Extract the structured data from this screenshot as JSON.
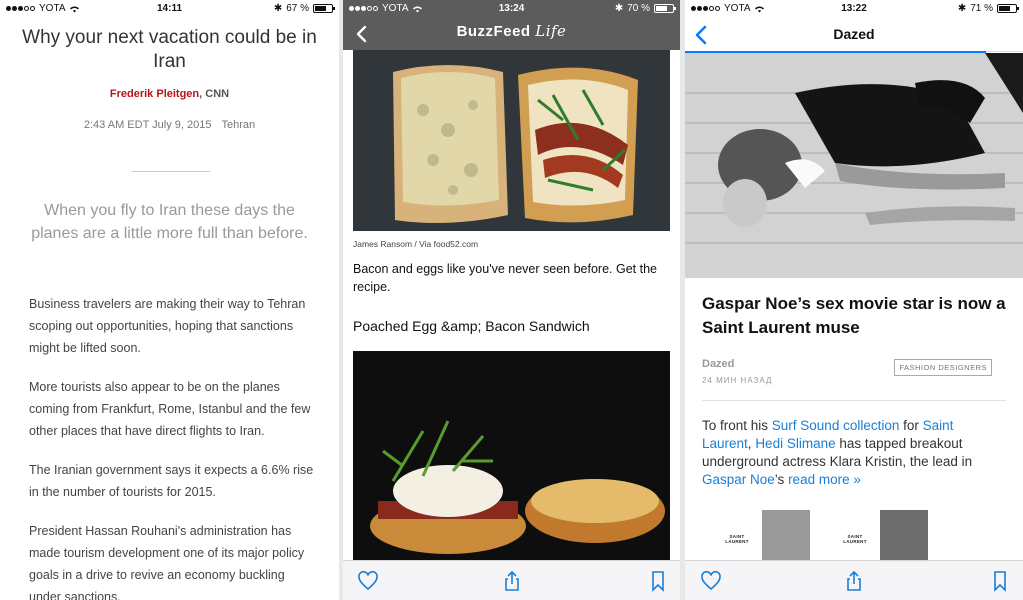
{
  "colors": {
    "cnn_red": "#b5121b",
    "ios_blue": "#0a7aff",
    "link_blue": "#1a7ed6",
    "buzzfeed_bar": "#5c5c5c"
  },
  "panel1": {
    "status": {
      "carrier": "YOTA",
      "time": "14:11",
      "battery": "67 %",
      "battery_level": 0.67
    },
    "title": "Why your next vacation could be in Iran",
    "author": "Frederik Pleitgen",
    "source": ", CNN",
    "date": "2:43 AM EDT July 9, 2015",
    "location": "Tehran",
    "lede": "When you fly to Iran these days the planes are a little more full than before.",
    "paragraphs": [
      "Business travelers are making their way to Tehran scoping out opportunities, hoping that sanctions might be lifted soon.",
      "More tourists also appear to be on the planes coming from Frankfurt, Rome, Istanbul and the few other places that have direct flights to Iran.",
      "The Iranian government says it expects a 6.6% rise in the number of tourists for 2015.",
      "President Hassan Rouhani's administration has made tourism development one of its major policy goals in a drive to revive an economy buckling under sanctions."
    ]
  },
  "panel2": {
    "status": {
      "carrier": "YOTA",
      "time": "13:24",
      "battery": "70 %",
      "battery_level": 0.7
    },
    "logo": "BuzzFeed",
    "logo_suffix": "Life",
    "credit": "James Ransom / Via food52.com",
    "caption": "Bacon and eggs like you've never seen before. Get the recipe.",
    "heading": "Poached Egg &amp; Bacon Sandwich",
    "toolbar": [
      "heart-icon",
      "share-icon",
      "bookmark-icon"
    ]
  },
  "panel3": {
    "status": {
      "carrier": "YOTA",
      "time": "13:22",
      "battery": "71 %",
      "battery_level": 0.71
    },
    "nav_title": "Dazed",
    "read_progress": 0.89,
    "headline": "Gaspar Noe’s sex movie star is now a Saint Laurent muse",
    "publisher": "Dazed",
    "time_ago": "24 МИН НАЗАД",
    "tag": "FASHION DESIGNERS",
    "text": {
      "t1": "To front his ",
      "l1": "Surf Sound collection",
      "t2": " for ",
      "l2": "Saint Laurent",
      "t3": ", ",
      "l3": "Hedi Slimane",
      "t4": " has tapped breakout underground actress Klara Kristin, the lead in ",
      "l4": "Gaspar Noe",
      "t5": "’s ",
      "l5": "read more »"
    },
    "thumb_label": "SAINT LAURENT",
    "toolbar": [
      "heart-icon",
      "share-icon",
      "bookmark-icon"
    ]
  }
}
